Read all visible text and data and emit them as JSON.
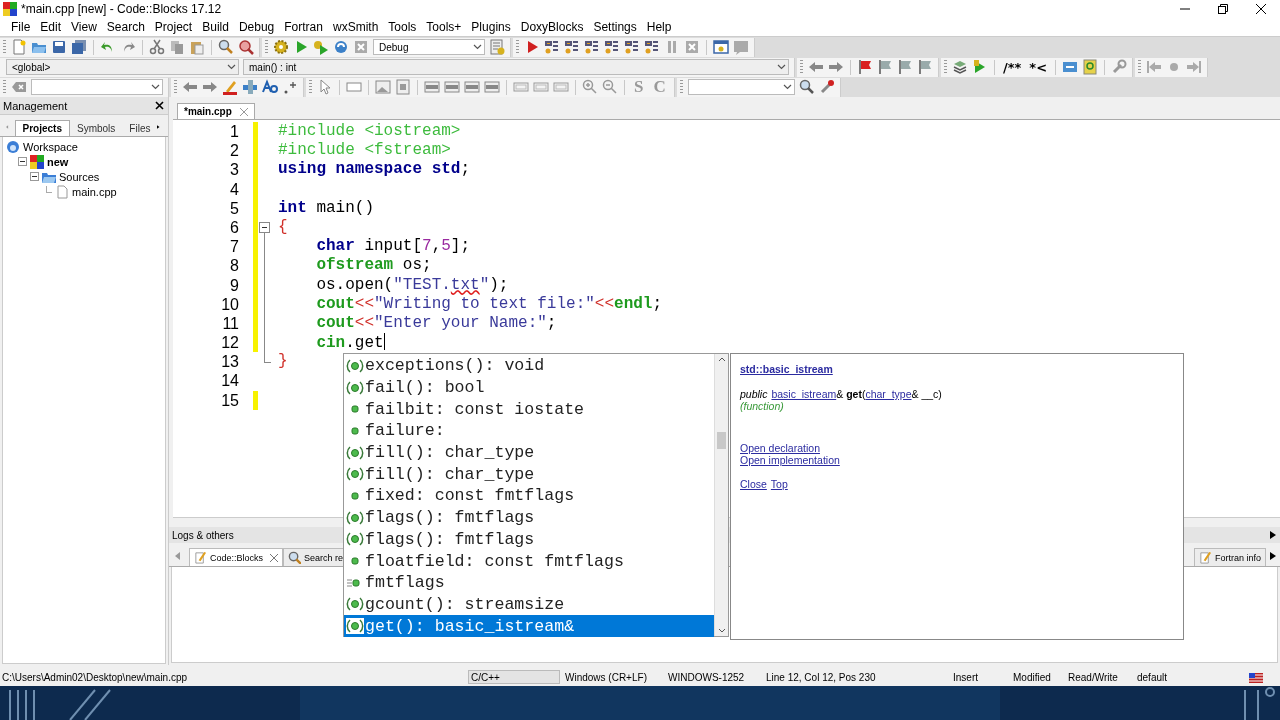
{
  "window": {
    "title": "*main.cpp [new] - Code::Blocks 17.12"
  },
  "menu": [
    "File",
    "Edit",
    "View",
    "Search",
    "Project",
    "Build",
    "Debug",
    "Fortran",
    "wxSmith",
    "Tools",
    "Tools+",
    "Plugins",
    "DoxyBlocks",
    "Settings",
    "Help"
  ],
  "toolbar": {
    "build_target": "Debug",
    "scope": "<global>",
    "function": "main() : int",
    "doxy_buttons": [
      "/**",
      "*<"
    ],
    "text_buttons": [
      "S",
      "C"
    ]
  },
  "management": {
    "title": "Management",
    "tabs": [
      {
        "label": "Projects",
        "selected": true
      },
      {
        "label": "Symbols",
        "selected": false
      },
      {
        "label": "Files",
        "selected": false
      }
    ],
    "tree": [
      {
        "label": "Workspace",
        "kind": "workspace",
        "children": [
          {
            "label": "new",
            "kind": "project",
            "expanded": true,
            "children": [
              {
                "label": "Sources",
                "kind": "folder",
                "expanded": true,
                "children": [
                  {
                    "label": "main.cpp",
                    "kind": "file"
                  }
                ]
              }
            ]
          }
        ]
      }
    ]
  },
  "editor": {
    "tabs": [
      {
        "label": "*main.cpp",
        "selected": true
      }
    ],
    "lines": [
      {
        "number": "1",
        "changed": true,
        "tokens": [
          {
            "kind": "preproc",
            "text": "#include <iostream>"
          }
        ]
      },
      {
        "number": "2",
        "changed": true,
        "tokens": [
          {
            "kind": "preproc",
            "text": "#include <fstream>"
          }
        ]
      },
      {
        "number": "3",
        "changed": true,
        "tokens": [
          {
            "kind": "keyword",
            "text": "using namespace std"
          },
          {
            "kind": "text",
            "text": ";"
          }
        ]
      },
      {
        "number": "4",
        "changed": true
      },
      {
        "number": "5",
        "changed": true,
        "tokens": [
          {
            "kind": "keyword",
            "text": "int"
          },
          {
            "kind": "text",
            "text": " main()"
          }
        ]
      },
      {
        "number": "6",
        "changed": true,
        "fold_expanded": true,
        "tokens": [
          {
            "kind": "operator",
            "text": "{"
          }
        ]
      },
      {
        "number": "7",
        "changed": true,
        "tokens": [
          {
            "kind": "keyword",
            "text": "    char"
          },
          {
            "kind": "text",
            "text": " input["
          },
          {
            "kind": "number",
            "text": "7"
          },
          {
            "kind": "text",
            "text": ","
          },
          {
            "kind": "number",
            "text": "5"
          },
          {
            "kind": "text",
            "text": "];"
          }
        ]
      },
      {
        "number": "8",
        "changed": true,
        "tokens": [
          {
            "kind": "type",
            "text": "    ofstream"
          },
          {
            "kind": "text",
            "text": " os;"
          }
        ]
      },
      {
        "number": "9",
        "changed": true,
        "tokens": [
          {
            "kind": "text",
            "text": "    os.open("
          },
          {
            "kind": "string",
            "text": "\"TEST."
          },
          {
            "kind": "string",
            "text": "txt",
            "misspelled": true
          },
          {
            "kind": "string",
            "text": "\""
          },
          {
            "kind": "text",
            "text": ");"
          }
        ]
      },
      {
        "number": "10",
        "changed": true,
        "tokens": [
          {
            "kind": "type",
            "text": "    cout"
          },
          {
            "kind": "operator",
            "text": "<<"
          },
          {
            "kind": "string",
            "text": "\"Writing to text file:\""
          },
          {
            "kind": "operator",
            "text": "<<"
          },
          {
            "kind": "type",
            "text": "endl"
          },
          {
            "kind": "text",
            "text": ";"
          }
        ]
      },
      {
        "number": "11",
        "changed": true,
        "tokens": [
          {
            "kind": "type",
            "text": "    cout"
          },
          {
            "kind": "operator",
            "text": "<<"
          },
          {
            "kind": "string",
            "text": "\"Enter your Name:\""
          },
          {
            "kind": "text",
            "text": ";"
          }
        ]
      },
      {
        "number": "12",
        "changed": true,
        "caret": true,
        "tokens": [
          {
            "kind": "type",
            "text": "    cin"
          },
          {
            "kind": "text",
            "text": ".get"
          }
        ]
      },
      {
        "number": "13",
        "changed": false,
        "fold_end": true,
        "tokens": [
          {
            "kind": "operator",
            "text": "}"
          }
        ]
      },
      {
        "number": "14",
        "changed": false
      },
      {
        "number": "15",
        "changed": true
      }
    ]
  },
  "completion": {
    "items": [
      {
        "text": "exceptions(): void",
        "kind": "function",
        "selected": false
      },
      {
        "text": "fail(): bool",
        "kind": "function",
        "selected": false
      },
      {
        "text": "failbit: const iostate",
        "kind": "variable",
        "selected": false
      },
      {
        "text": "failure:",
        "kind": "variable",
        "selected": false
      },
      {
        "text": "fill(): char_type",
        "kind": "function",
        "selected": false
      },
      {
        "text": "fill(): char_type",
        "kind": "function",
        "selected": false
      },
      {
        "text": "fixed: const fmtflags",
        "kind": "variable",
        "selected": false
      },
      {
        "text": "flags(): fmtflags",
        "kind": "function",
        "selected": false
      },
      {
        "text": "flags(): fmtflags",
        "kind": "function",
        "selected": false
      },
      {
        "text": "floatfield: const fmtflags",
        "kind": "variable",
        "selected": false
      },
      {
        "text": "fmtflags",
        "kind": "typedef",
        "selected": false
      },
      {
        "text": "gcount(): streamsize",
        "kind": "function",
        "selected": false
      },
      {
        "text": "get(): basic_istream&",
        "kind": "function",
        "selected": true
      }
    ]
  },
  "doc_popup": {
    "scope": "std::basic_istream",
    "signature": [
      {
        "kind": "modifier",
        "text": "public"
      },
      {
        "kind": "link",
        "text": "basic_istream"
      },
      {
        "kind": "text",
        "text": "& "
      },
      {
        "kind": "name",
        "text": "get"
      },
      {
        "kind": "text",
        "text": "("
      },
      {
        "kind": "link",
        "text": "char_type"
      },
      {
        "kind": "text",
        "text": "& __c)"
      }
    ],
    "category": "(function)",
    "links": [
      "Open declaration",
      "Open implementation"
    ],
    "footer_links": [
      "Close",
      "Top"
    ]
  },
  "logs": {
    "title": "Logs & others",
    "tabs": [
      {
        "label": "Code::Blocks",
        "selected": true
      },
      {
        "label": "Search re",
        "selected": false
      }
    ],
    "right_tab": "Fortran info"
  },
  "status_bar": [
    "C:\\Users\\Admin02\\Desktop\\new\\main.cpp",
    "C/C++",
    "Windows (CR+LF)",
    "WINDOWS-1252",
    "Line 12, Col 12, Pos 230",
    "Insert",
    "Modified",
    "Read/Write",
    "default"
  ]
}
